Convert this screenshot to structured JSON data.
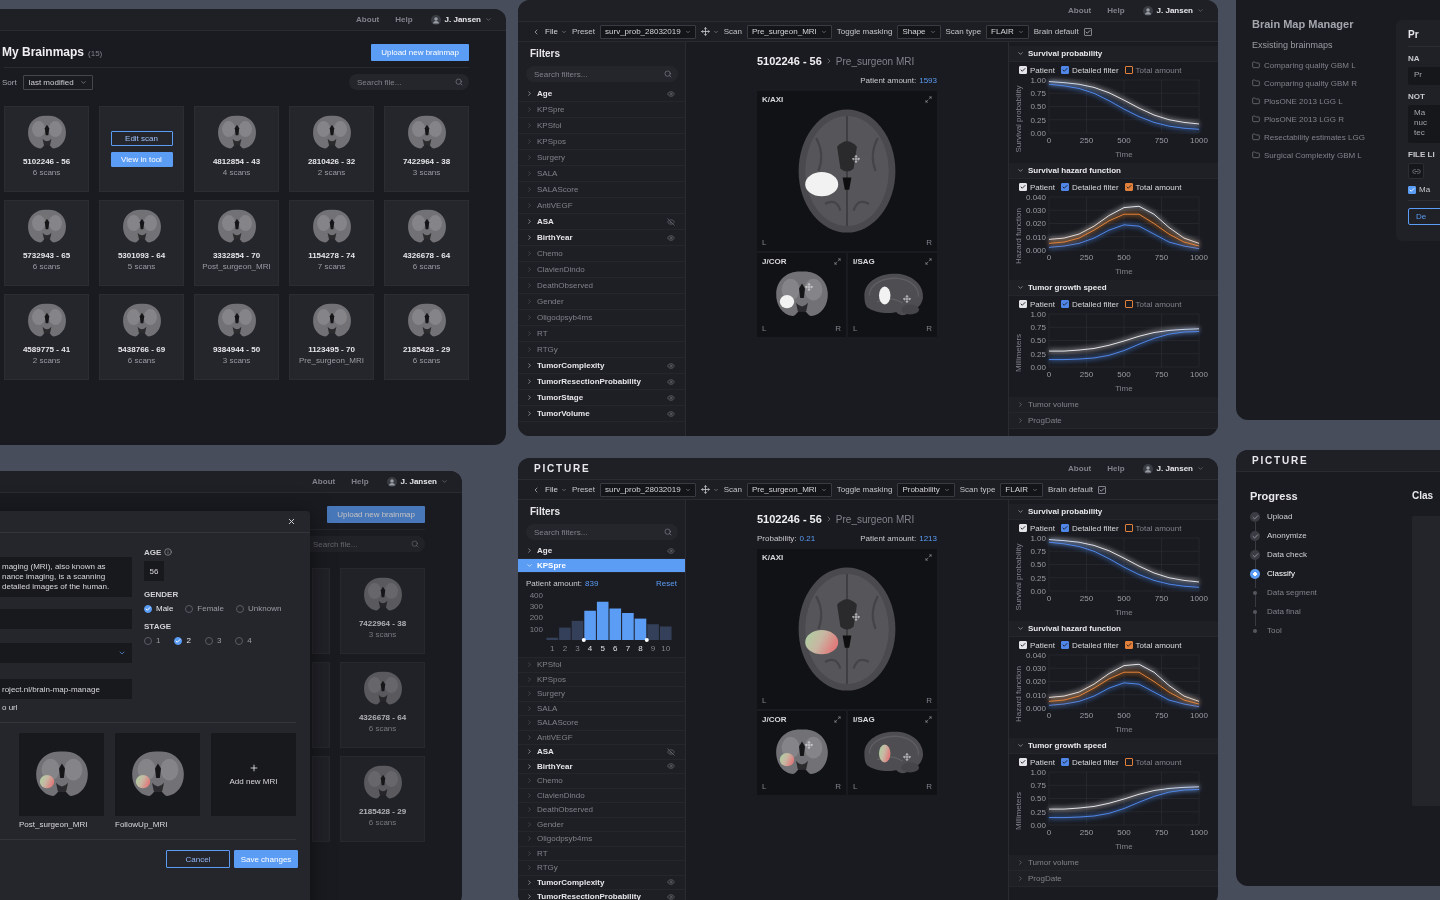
{
  "brainmaps_page": {
    "nav": {
      "links": [
        "About",
        "Help"
      ],
      "user": "J. Jansen"
    },
    "title": "My Brainmaps",
    "count": "(15)",
    "upload_button": "Upload new brainmap",
    "sort": {
      "label": "Sort",
      "value": "last modified"
    },
    "search": {
      "placeholder": "Search file..."
    },
    "cards": [
      {
        "kind": "scan",
        "title": "5102246 - 56",
        "subtitle": "6 scans"
      },
      {
        "kind": "actions",
        "actions": [
          {
            "kind": "outline",
            "label": "Edit scan"
          },
          {
            "kind": "primary",
            "label": "View in tool"
          }
        ]
      },
      {
        "kind": "scan",
        "title": "4812854 - 43",
        "subtitle": "4 scans"
      },
      {
        "kind": "scan",
        "title": "2810426 - 32",
        "subtitle": "2 scans"
      },
      {
        "kind": "scan",
        "title": "7422964 - 38",
        "subtitle": "3 scans"
      },
      {
        "kind": "scan",
        "title": "5732943 - 65",
        "subtitle": "6 scans"
      },
      {
        "kind": "scan",
        "title": "5301093 - 64",
        "subtitle": "5 scans"
      },
      {
        "kind": "scan",
        "title": "3332854 - 70",
        "subtitle": "Post_surgeon_MRI"
      },
      {
        "kind": "scan",
        "title": "1154278 - 74",
        "subtitle": "7 scans"
      },
      {
        "kind": "scan",
        "title": "4326678 - 64",
        "subtitle": "6 scans"
      },
      {
        "kind": "scan",
        "title": "4589775 - 41",
        "subtitle": "2 scans"
      },
      {
        "kind": "scan",
        "title": "5438766 - 69",
        "subtitle": "6 scans"
      },
      {
        "kind": "scan",
        "title": "9384944 - 50",
        "subtitle": "3 scans"
      },
      {
        "kind": "scan",
        "title": "1123495 - 70",
        "subtitle": "Pre_surgeon_MRI"
      },
      {
        "kind": "scan",
        "title": "2185428 - 29",
        "subtitle": "6 scans"
      }
    ]
  },
  "viewer_shape": {
    "nav": {
      "links": [
        "About",
        "Help"
      ],
      "user": "J. Jansen"
    },
    "toolbar": {
      "file_menu": "File",
      "preset": {
        "label": "Preset",
        "value": "surv_prob_28032019"
      },
      "scan": {
        "label": "Scan",
        "value": "Pre_surgeon_MRI"
      },
      "masking": {
        "label": "Toggle masking",
        "value": "Shape"
      },
      "scan_type": {
        "label": "Scan type",
        "value": "FLAIR"
      },
      "brain_default": {
        "label": "Brain default",
        "checked": true
      }
    },
    "filters": {
      "title": "Filters",
      "search_placeholder": "Search filters...",
      "items": [
        {
          "label": "Age",
          "enabled": true,
          "selected": false,
          "expanded": false,
          "visible": true
        },
        {
          "label": "KPSpre",
          "enabled": false,
          "selected": false,
          "expanded": false
        },
        {
          "label": "KPSfol",
          "enabled": false,
          "selected": false,
          "expanded": false
        },
        {
          "label": "KPSpos",
          "enabled": false,
          "selected": false,
          "expanded": false
        },
        {
          "label": "Surgery",
          "enabled": false,
          "selected": false,
          "expanded": false
        },
        {
          "label": "SALA",
          "enabled": false,
          "selected": false,
          "expanded": false
        },
        {
          "label": "SALAScore",
          "enabled": false,
          "selected": false,
          "expanded": false
        },
        {
          "label": "AntiVEGF",
          "enabled": false,
          "selected": false,
          "expanded": false
        },
        {
          "label": "ASA",
          "enabled": true,
          "selected": false,
          "expanded": false,
          "visible": false
        },
        {
          "label": "BirthYear",
          "enabled": true,
          "selected": false,
          "expanded": false,
          "visible": true
        },
        {
          "label": "Chemo",
          "enabled": false,
          "selected": false,
          "expanded": false
        },
        {
          "label": "ClavienDindo",
          "enabled": false,
          "selected": false,
          "expanded": false
        },
        {
          "label": "DeathObserved",
          "enabled": false,
          "selected": false,
          "expanded": false
        },
        {
          "label": "Gender",
          "enabled": false,
          "selected": false,
          "expanded": false
        },
        {
          "label": "Oligodpsyb4ms",
          "enabled": false,
          "selected": false,
          "expanded": false
        },
        {
          "label": "RT",
          "enabled": false,
          "selected": false,
          "expanded": false
        },
        {
          "label": "RTGy",
          "enabled": false,
          "selected": false,
          "expanded": false
        },
        {
          "label": "TumorComplexity",
          "enabled": true,
          "selected": false,
          "expanded": false,
          "visible": true
        },
        {
          "label": "TumorResectionProbability",
          "enabled": true,
          "selected": false,
          "expanded": false,
          "visible": true
        },
        {
          "label": "TumorStage",
          "enabled": true,
          "selected": false,
          "expanded": false,
          "visible": true
        },
        {
          "label": "TumorVolume",
          "enabled": true,
          "selected": false,
          "expanded": false,
          "visible": true
        }
      ]
    },
    "scan": {
      "id": "5102246 - 56",
      "name": "Pre_surgeon MRI",
      "patient_amount": {
        "label": "Patient amount:",
        "value": "1593"
      },
      "mask": {
        "kind": "shape"
      },
      "views": [
        {
          "kind": "axial",
          "label": "K/AXI",
          "left": "L",
          "right": "R"
        },
        {
          "kind": "coronal",
          "label": "J/COR",
          "left": "L",
          "right": "R"
        },
        {
          "kind": "sagittal",
          "label": "I/SAG",
          "left": "L",
          "right": "R"
        }
      ]
    },
    "sections": [
      {
        "title": "Survival probability",
        "expanded": true,
        "toggles": [
          {
            "checked": true
          },
          {
            "checked": true
          },
          {
            "checked": false
          }
        ],
        "chart_data": {
          "type": "line",
          "grid": true,
          "legend": "top",
          "xlabel": "Time",
          "ylabel": "Survival probability",
          "x": [
            0,
            100,
            200,
            300,
            400,
            500,
            600,
            700,
            800,
            900,
            1000
          ],
          "series": [
            {
              "name": "Patient",
              "color": "#e4e4e8",
              "values": [
                0.97,
                0.95,
                0.92,
                0.86,
                0.76,
                0.62,
                0.47,
                0.34,
                0.25,
                0.2,
                0.17
              ]
            },
            {
              "name": "Detailed filter",
              "color": "#4f86e8",
              "values": [
                0.92,
                0.89,
                0.84,
                0.75,
                0.61,
                0.45,
                0.31,
                0.2,
                0.13,
                0.09,
                0.07
              ]
            },
            {
              "name": "Total amount",
              "color": "#e0803a",
              "values": [
                null,
                null,
                null,
                null,
                null,
                null,
                null,
                null,
                null,
                null,
                null
              ]
            }
          ],
          "xlim": [
            0,
            1000
          ],
          "ylim": [
            0,
            1
          ],
          "xticks": [
            0,
            250,
            500,
            750,
            1000
          ],
          "yticks": [
            {
              "value": 0,
              "label": "0.00"
            },
            {
              "value": 0.25,
              "label": "0.25"
            },
            {
              "value": 0.5,
              "label": "0.50"
            },
            {
              "value": 0.75,
              "label": "0.75"
            },
            {
              "value": 1,
              "label": "1.00"
            }
          ]
        }
      },
      {
        "title": "Survival hazard function",
        "expanded": true,
        "toggles": [
          {
            "checked": true
          },
          {
            "checked": true
          },
          {
            "checked": true
          }
        ],
        "chart_data": {
          "type": "line",
          "grid": true,
          "legend": "top",
          "xlabel": "Time",
          "ylabel": "Hazard function",
          "x": [
            0,
            100,
            200,
            300,
            400,
            500,
            600,
            700,
            800,
            900,
            1000
          ],
          "series": [
            {
              "name": "Patient",
              "color": "#e4e4e8",
              "values": [
                0.008,
                0.009,
                0.012,
                0.018,
                0.026,
                0.032,
                0.033,
                0.027,
                0.017,
                0.009,
                0.005
              ]
            },
            {
              "name": "Detailed filter",
              "color": "#4f86e8",
              "values": [
                0.002,
                0.003,
                0.005,
                0.009,
                0.015,
                0.019,
                0.018,
                0.012,
                0.006,
                0.003,
                0.001
              ]
            },
            {
              "name": "Total amount",
              "color": "#e0803a",
              "values": [
                0.005,
                0.006,
                0.009,
                0.015,
                0.022,
                0.027,
                0.027,
                0.02,
                0.012,
                0.006,
                0.003
              ]
            }
          ],
          "xlim": [
            0,
            1000
          ],
          "ylim": [
            0,
            0.04
          ],
          "xticks": [
            0,
            250,
            500,
            750,
            1000
          ],
          "yticks": [
            {
              "value": 0,
              "label": "0.000"
            },
            {
              "value": 0.01,
              "label": "0.010"
            },
            {
              "value": 0.02,
              "label": "0.020"
            },
            {
              "value": 0.03,
              "label": "0.030"
            },
            {
              "value": 0.04,
              "label": "0.040"
            }
          ]
        }
      },
      {
        "title": "Tumor growth speed",
        "expanded": true,
        "toggles": [
          {
            "checked": true
          },
          {
            "checked": true
          },
          {
            "checked": false
          }
        ],
        "chart_data": {
          "type": "line",
          "grid": true,
          "legend": "top",
          "xlabel": "Time",
          "ylabel": "Millimeters",
          "x": [
            0,
            100,
            200,
            300,
            400,
            500,
            600,
            700,
            800,
            900,
            1000
          ],
          "series": [
            {
              "name": "Patient",
              "color": "#e4e4e8",
              "values": [
                0.3,
                0.3,
                0.32,
                0.35,
                0.41,
                0.49,
                0.58,
                0.65,
                0.69,
                0.71,
                0.72
              ]
            },
            {
              "name": "Detailed filter",
              "color": "#4f86e8",
              "values": [
                0.14,
                0.14,
                0.15,
                0.17,
                0.22,
                0.31,
                0.43,
                0.54,
                0.62,
                0.66,
                0.67
              ]
            },
            {
              "name": "Total amount",
              "color": "#e0803a",
              "values": [
                null,
                null,
                null,
                null,
                null,
                null,
                null,
                null,
                null,
                null,
                null
              ]
            }
          ],
          "xlim": [
            0,
            1000
          ],
          "ylim": [
            0,
            1
          ],
          "xticks": [
            0,
            250,
            500,
            750,
            1000
          ],
          "yticks": [
            {
              "value": 0,
              "label": "0.00"
            },
            {
              "value": 0.25,
              "label": "0.25"
            },
            {
              "value": 0.5,
              "label": "0.50"
            },
            {
              "value": 0.75,
              "label": "0.75"
            },
            {
              "value": 1,
              "label": "1.00"
            }
          ]
        }
      },
      {
        "title": "Tumor volume",
        "expanded": false
      },
      {
        "title": "ProgDate",
        "expanded": false
      }
    ]
  },
  "brain_map_manager": {
    "title": "Brain Map Manager",
    "subtitle": "Exsisting brainmaps",
    "items": [
      "Comparing quality GBM L",
      "Comparing quality GBM R",
      "PlosONE 2013 LGG L",
      "PlosONE 2013 LGG R",
      "Resectability estimates LGG",
      "Surgical Complexity GBM L"
    ],
    "detail": {
      "title": "Pr",
      "name_label": "NA",
      "name_value": "Pr",
      "notes_label": "NOT",
      "notes_lines": [
        "Ma",
        "nuc",
        "tec"
      ],
      "files_label": "FILE LI",
      "option": {
        "label": "Ma",
        "checked": true
      },
      "delete_button": "De"
    }
  },
  "edit_brainmap": {
    "nav": {
      "links": [
        "About",
        "Help"
      ],
      "user": "J. Jansen"
    },
    "upload_button": "Upload new brainmap",
    "search": {
      "placeholder": "Search file..."
    },
    "cards": [
      {
        "title": "7422964 - 38",
        "subtitle": "3 scans"
      },
      {
        "title": "4326678 - 64",
        "subtitle": "6 scans"
      },
      {
        "title": "2185428 - 29",
        "subtitle": "6 scans"
      }
    ],
    "modal": {
      "description_lines": [
        "maging (MRI), also known as",
        "nance imaging, is a scanning",
        "detailed images of the human."
      ],
      "fields": [
        {
          "kind": "input"
        },
        {
          "kind": "select"
        },
        {
          "kind": "url",
          "value": "roject.nl/brain-map-manage",
          "hint": "o url"
        }
      ],
      "age": {
        "label": "AGE",
        "value": "56"
      },
      "gender": {
        "label": "GENDER",
        "options": [
          {
            "label": "Male",
            "selected": true
          },
          {
            "label": "Female",
            "selected": false
          },
          {
            "label": "Unknown",
            "selected": false
          }
        ]
      },
      "stage": {
        "label": "STAGE",
        "options": [
          {
            "label": "1",
            "selected": false
          },
          {
            "label": "2",
            "selected": true
          },
          {
            "label": "3",
            "selected": false
          },
          {
            "label": "4",
            "selected": false
          }
        ]
      },
      "mri_tiles": [
        {
          "kind": "scan",
          "label": "Post_surgeon_MRI"
        },
        {
          "kind": "scan",
          "label": "FollowUp_MRI"
        },
        {
          "kind": "add",
          "label": "Add new MRI"
        }
      ],
      "buttons": [
        {
          "kind": "secondary",
          "label": "Cancel"
        },
        {
          "kind": "primary",
          "label": "Save changes"
        }
      ]
    }
  },
  "viewer_probability": {
    "logo": "PICTURE",
    "nav": {
      "links": [
        "About",
        "Help"
      ],
      "user": "J. Jansen"
    },
    "toolbar": {
      "file_menu": "File",
      "preset": {
        "label": "Preset",
        "value": "surv_prob_28032019"
      },
      "scan": {
        "label": "Scan",
        "value": "Pre_surgeon_MRI"
      },
      "masking": {
        "label": "Toggle masking",
        "value": "Probability"
      },
      "scan_type": {
        "label": "Scan type",
        "value": "FLAIR"
      },
      "brain_default": {
        "label": "Brain default",
        "checked": true
      }
    },
    "filters": {
      "title": "Filters",
      "search_placeholder": "Search filters...",
      "items": [
        {
          "label": "Age",
          "enabled": true,
          "selected": false,
          "expanded": false,
          "visible": true
        },
        {
          "label": "KPSpre",
          "enabled": true,
          "selected": true,
          "expanded": true,
          "histogram": {
            "patient_amount": {
              "label": "Patient amount:",
              "value": "839"
            },
            "reset": "Reset",
            "bins": [
              {
                "selected": false
              },
              {
                "selected": false
              },
              {
                "selected": false
              },
              {
                "selected": true
              },
              {
                "selected": true
              },
              {
                "selected": true
              },
              {
                "selected": true
              },
              {
                "selected": true
              },
              {
                "selected": false
              },
              {
                "selected": false
              }
            ],
            "chart_data": {
              "type": "bar",
              "categories": [
                "1",
                "2",
                "3",
                "4",
                "5",
                "6",
                "7",
                "8",
                "9",
                "10"
              ],
              "values": [
                20,
                110,
                170,
                260,
                340,
                280,
                240,
                190,
                140,
                120
              ],
              "ylim": [
                0,
                400
              ],
              "yticks": [
                100,
                200,
                300,
                400
              ]
            }
          }
        },
        {
          "label": "KPSfol",
          "enabled": false,
          "selected": false,
          "expanded": false
        },
        {
          "label": "KPSpos",
          "enabled": false,
          "selected": false,
          "expanded": false
        },
        {
          "label": "Surgery",
          "enabled": false,
          "selected": false,
          "expanded": false
        },
        {
          "label": "SALA",
          "enabled": false,
          "selected": false,
          "expanded": false
        },
        {
          "label": "SALAScore",
          "enabled": false,
          "selected": false,
          "expanded": false
        },
        {
          "label": "AntiVEGF",
          "enabled": false,
          "selected": false,
          "expanded": false
        },
        {
          "label": "ASA",
          "enabled": true,
          "selected": false,
          "expanded": false,
          "visible": false
        },
        {
          "label": "BirthYear",
          "enabled": true,
          "selected": false,
          "expanded": false,
          "visible": true
        },
        {
          "label": "Chemo",
          "enabled": false,
          "selected": false,
          "expanded": false
        },
        {
          "label": "ClavienDindo",
          "enabled": false,
          "selected": false,
          "expanded": false
        },
        {
          "label": "DeathObserved",
          "enabled": false,
          "selected": false,
          "expanded": false
        },
        {
          "label": "Gender",
          "enabled": false,
          "selected": false,
          "expanded": false
        },
        {
          "label": "Oligodpsyb4ms",
          "enabled": false,
          "selected": false,
          "expanded": false
        },
        {
          "label": "RT",
          "enabled": false,
          "selected": false,
          "expanded": false
        },
        {
          "label": "RTGy",
          "enabled": false,
          "selected": false,
          "expanded": false
        },
        {
          "label": "TumorComplexity",
          "enabled": true,
          "selected": false,
          "expanded": false,
          "visible": true
        },
        {
          "label": "TumorResectionProbability",
          "enabled": true,
          "selected": false,
          "expanded": false,
          "visible": true
        }
      ]
    },
    "scan": {
      "id": "5102246 - 56",
      "name": "Pre_surgeon MRI",
      "probability": {
        "label": "Probability:",
        "value": "0.21"
      },
      "patient_amount": {
        "label": "Patient amount:",
        "value": "1213"
      },
      "mask": {
        "kind": "probability"
      },
      "views": [
        {
          "kind": "axial",
          "label": "K/AXI",
          "left": "L",
          "right": "R"
        },
        {
          "kind": "coronal",
          "label": "J/COR",
          "left": "L",
          "right": "R"
        },
        {
          "kind": "sagittal",
          "label": "I/SAG",
          "left": "L",
          "right": "R"
        }
      ]
    },
    "sections": [
      {
        "title": "Survival probability",
        "expanded": true,
        "toggles": [
          {
            "checked": true
          },
          {
            "checked": true
          },
          {
            "checked": false
          }
        ],
        "chart_data": {
          "type": "line",
          "grid": true,
          "legend": "top",
          "xlabel": "Time",
          "ylabel": "Survival probability",
          "x": [
            0,
            100,
            200,
            300,
            400,
            500,
            600,
            700,
            800,
            900,
            1000
          ],
          "series": [
            {
              "name": "Patient",
              "color": "#e4e4e8",
              "values": [
                0.97,
                0.95,
                0.92,
                0.86,
                0.76,
                0.62,
                0.47,
                0.34,
                0.25,
                0.2,
                0.17
              ]
            },
            {
              "name": "Detailed filter",
              "color": "#4f86e8",
              "values": [
                0.92,
                0.89,
                0.84,
                0.75,
                0.61,
                0.45,
                0.31,
                0.2,
                0.13,
                0.09,
                0.07
              ]
            },
            {
              "name": "Total amount",
              "color": "#e0803a",
              "values": [
                null,
                null,
                null,
                null,
                null,
                null,
                null,
                null,
                null,
                null,
                null
              ]
            }
          ],
          "xlim": [
            0,
            1000
          ],
          "ylim": [
            0,
            1
          ],
          "xticks": [
            0,
            250,
            500,
            750,
            1000
          ],
          "yticks": [
            {
              "value": 0,
              "label": "0.00"
            },
            {
              "value": 0.25,
              "label": "0.25"
            },
            {
              "value": 0.5,
              "label": "0.50"
            },
            {
              "value": 0.75,
              "label": "0.75"
            },
            {
              "value": 1,
              "label": "1.00"
            }
          ]
        }
      },
      {
        "title": "Survival hazard function",
        "expanded": true,
        "toggles": [
          {
            "checked": true
          },
          {
            "checked": true
          },
          {
            "checked": true
          }
        ],
        "chart_data": {
          "type": "line",
          "grid": true,
          "legend": "top",
          "xlabel": "Time",
          "ylabel": "Hazard function",
          "x": [
            0,
            100,
            200,
            300,
            400,
            500,
            600,
            700,
            800,
            900,
            1000
          ],
          "series": [
            {
              "name": "Patient",
              "color": "#e4e4e8",
              "values": [
                0.008,
                0.009,
                0.012,
                0.018,
                0.026,
                0.032,
                0.033,
                0.027,
                0.017,
                0.009,
                0.005
              ]
            },
            {
              "name": "Detailed filter",
              "color": "#4f86e8",
              "values": [
                0.002,
                0.003,
                0.005,
                0.009,
                0.015,
                0.019,
                0.018,
                0.012,
                0.006,
                0.003,
                0.001
              ]
            },
            {
              "name": "Total amount",
              "color": "#e0803a",
              "values": [
                0.005,
                0.006,
                0.009,
                0.015,
                0.022,
                0.027,
                0.027,
                0.02,
                0.012,
                0.006,
                0.003
              ]
            }
          ],
          "xlim": [
            0,
            1000
          ],
          "ylim": [
            0,
            0.04
          ],
          "xticks": [
            0,
            250,
            500,
            750,
            1000
          ],
          "yticks": [
            {
              "value": 0,
              "label": "0.000"
            },
            {
              "value": 0.01,
              "label": "0.010"
            },
            {
              "value": 0.02,
              "label": "0.020"
            },
            {
              "value": 0.03,
              "label": "0.030"
            },
            {
              "value": 0.04,
              "label": "0.040"
            }
          ]
        }
      },
      {
        "title": "Tumor growth speed",
        "expanded": true,
        "toggles": [
          {
            "checked": true
          },
          {
            "checked": true
          },
          {
            "checked": false
          }
        ],
        "chart_data": {
          "type": "line",
          "grid": true,
          "legend": "top",
          "xlabel": "Time",
          "ylabel": "Millimeters",
          "x": [
            0,
            100,
            200,
            300,
            400,
            500,
            600,
            700,
            800,
            900,
            1000
          ],
          "series": [
            {
              "name": "Patient",
              "color": "#e4e4e8",
              "values": [
                0.3,
                0.3,
                0.32,
                0.35,
                0.41,
                0.49,
                0.58,
                0.65,
                0.69,
                0.71,
                0.72
              ]
            },
            {
              "name": "Detailed filter",
              "color": "#4f86e8",
              "values": [
                0.14,
                0.14,
                0.15,
                0.17,
                0.22,
                0.31,
                0.43,
                0.54,
                0.62,
                0.66,
                0.67
              ]
            },
            {
              "name": "Total amount",
              "color": "#e0803a",
              "values": [
                null,
                null,
                null,
                null,
                null,
                null,
                null,
                null,
                null,
                null,
                null
              ]
            }
          ],
          "xlim": [
            0,
            1000
          ],
          "ylim": [
            0,
            1
          ],
          "xticks": [
            0,
            250,
            500,
            750,
            1000
          ],
          "yticks": [
            {
              "value": 0,
              "label": "0.00"
            },
            {
              "value": 0.25,
              "label": "0.25"
            },
            {
              "value": 0.5,
              "label": "0.50"
            },
            {
              "value": 0.75,
              "label": "0.75"
            },
            {
              "value": 1,
              "label": "1.00"
            }
          ]
        }
      },
      {
        "title": "Tumor volume",
        "expanded": false
      },
      {
        "title": "ProgDate",
        "expanded": false
      }
    ]
  },
  "progress_page": {
    "logo": "PICTURE",
    "title": "Progress",
    "steps": [
      {
        "label": "Upload",
        "completed": true,
        "selected": false
      },
      {
        "label": "Anonymize",
        "completed": true,
        "selected": false
      },
      {
        "label": "Data check",
        "completed": true,
        "selected": false
      },
      {
        "label": "Classify",
        "completed": false,
        "selected": true
      },
      {
        "label": "Data segment",
        "completed": false,
        "selected": false
      },
      {
        "label": "Data final",
        "completed": false,
        "selected": false
      },
      {
        "label": "Tool",
        "completed": false,
        "selected": false
      }
    ],
    "content_title": "Clas"
  }
}
